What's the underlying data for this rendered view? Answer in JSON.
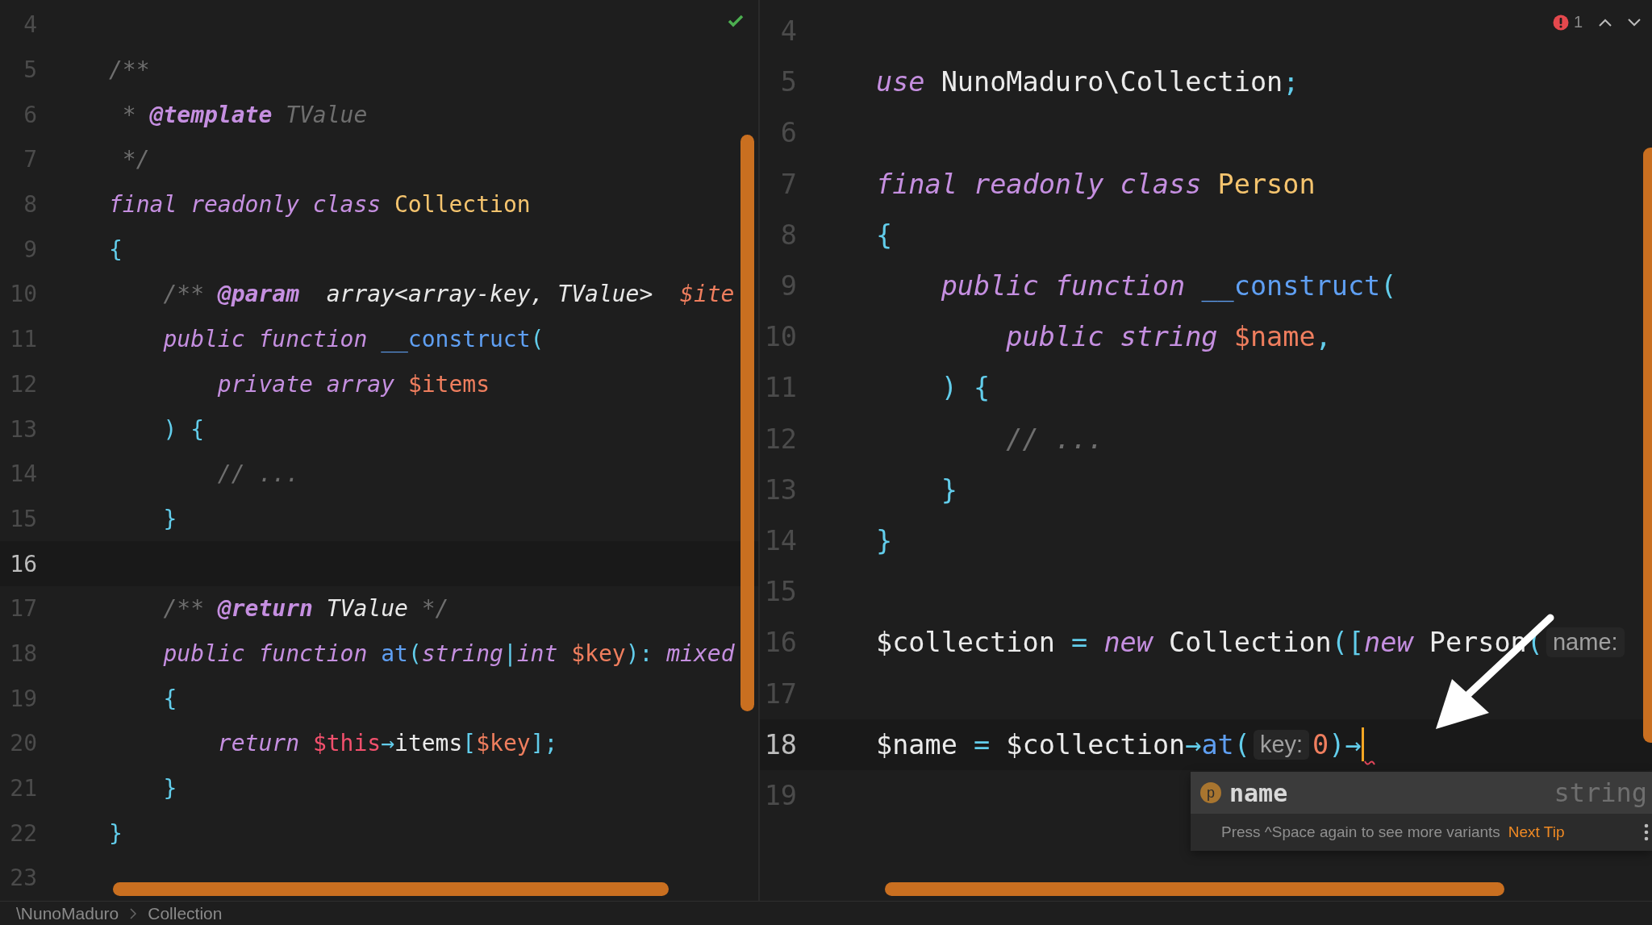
{
  "left_editor": {
    "has_errors": false,
    "lines": [
      {
        "number": "4",
        "current": false
      },
      {
        "number": "5",
        "current": false,
        "tokens": [
          {
            "kind": "comment",
            "text": "/**"
          }
        ]
      },
      {
        "number": "6",
        "current": false,
        "tokens": [
          {
            "kind": "comment",
            "text": " * "
          },
          {
            "kind": "doctag",
            "text": "@template"
          },
          {
            "kind": "comment",
            "text": " TValue"
          }
        ]
      },
      {
        "number": "7",
        "current": false,
        "tokens": [
          {
            "kind": "comment",
            "text": " */"
          }
        ]
      },
      {
        "number": "8",
        "current": false,
        "tokens": [
          {
            "kind": "keyword",
            "text": "final readonly class "
          },
          {
            "kind": "class",
            "text": "Collection"
          }
        ]
      },
      {
        "number": "9",
        "current": false,
        "tokens": [
          {
            "kind": "punct",
            "text": "{"
          }
        ]
      },
      {
        "number": "10",
        "current": false,
        "tokens": [
          {
            "kind": "comment",
            "text": "    /** "
          },
          {
            "kind": "doctag",
            "text": "@param"
          },
          {
            "kind": "doctype",
            "text": "  array<array-key, TValue>  "
          },
          {
            "kind": "docvar",
            "text": "$ite"
          }
        ]
      },
      {
        "number": "11",
        "current": false,
        "tokens": [
          {
            "kind": "keyword",
            "text": "    public function "
          },
          {
            "kind": "func",
            "text": "__construct"
          },
          {
            "kind": "punct",
            "text": "("
          }
        ]
      },
      {
        "number": "12",
        "current": false,
        "tokens": [
          {
            "kind": "keyword",
            "text": "        private array "
          },
          {
            "kind": "var",
            "text": "$items"
          }
        ]
      },
      {
        "number": "13",
        "current": false,
        "tokens": [
          {
            "kind": "punct",
            "text": "    ) {"
          }
        ]
      },
      {
        "number": "14",
        "current": false,
        "tokens": [
          {
            "kind": "comment",
            "text": "        // ..."
          }
        ]
      },
      {
        "number": "15",
        "current": false,
        "tokens": [
          {
            "kind": "punct",
            "text": "    }"
          }
        ]
      },
      {
        "number": "16",
        "current": true
      },
      {
        "number": "17",
        "current": false,
        "tokens": [
          {
            "kind": "comment",
            "text": "    /** "
          },
          {
            "kind": "doctag",
            "text": "@return"
          },
          {
            "kind": "doctype",
            "text": " TValue "
          },
          {
            "kind": "comment",
            "text": "*/"
          }
        ]
      },
      {
        "number": "18",
        "current": false,
        "tokens": [
          {
            "kind": "keyword",
            "text": "    public function "
          },
          {
            "kind": "func",
            "text": "at"
          },
          {
            "kind": "punct",
            "text": "("
          },
          {
            "kind": "keyword",
            "text": "string"
          },
          {
            "kind": "punct",
            "text": "|"
          },
          {
            "kind": "keyword",
            "text": "int "
          },
          {
            "kind": "var",
            "text": "$key"
          },
          {
            "kind": "punct",
            "text": "): "
          },
          {
            "kind": "keyword",
            "text": "mixed"
          }
        ]
      },
      {
        "number": "19",
        "current": false,
        "tokens": [
          {
            "kind": "punct",
            "text": "    {"
          }
        ]
      },
      {
        "number": "20",
        "current": false,
        "tokens": [
          {
            "kind": "keyword",
            "text": "        return "
          },
          {
            "kind": "this",
            "text": "$this"
          },
          {
            "kind": "punct",
            "text": "→"
          },
          {
            "kind": "plain",
            "text": "items"
          },
          {
            "kind": "punct",
            "text": "["
          },
          {
            "kind": "var",
            "text": "$key"
          },
          {
            "kind": "punct",
            "text": "];"
          }
        ]
      },
      {
        "number": "21",
        "current": false,
        "tokens": [
          {
            "kind": "punct",
            "text": "    }"
          }
        ]
      },
      {
        "number": "22",
        "current": false,
        "tokens": [
          {
            "kind": "punct",
            "text": "}"
          }
        ]
      },
      {
        "number": "23",
        "current": false
      }
    ]
  },
  "right_editor": {
    "has_errors": true,
    "problem_count": "1",
    "lines": [
      {
        "number": "4",
        "current": false
      },
      {
        "number": "5",
        "current": false,
        "tokens": [
          {
            "kind": "keyword",
            "text": "use "
          },
          {
            "kind": "plain",
            "text": "NunoMaduro\\Collection"
          },
          {
            "kind": "punct",
            "text": ";"
          }
        ]
      },
      {
        "number": "6",
        "current": false
      },
      {
        "number": "7",
        "current": false,
        "tokens": [
          {
            "kind": "keyword",
            "text": "final readonly class "
          },
          {
            "kind": "class",
            "text": "Person"
          }
        ]
      },
      {
        "number": "8",
        "current": false,
        "tokens": [
          {
            "kind": "punct",
            "text": "{"
          }
        ]
      },
      {
        "number": "9",
        "current": false,
        "tokens": [
          {
            "kind": "keyword",
            "text": "    public function "
          },
          {
            "kind": "func",
            "text": "__construct"
          },
          {
            "kind": "punct",
            "text": "("
          }
        ]
      },
      {
        "number": "10",
        "current": false,
        "tokens": [
          {
            "kind": "keyword",
            "text": "        public string "
          },
          {
            "kind": "var",
            "text": "$name"
          },
          {
            "kind": "punct",
            "text": ","
          }
        ]
      },
      {
        "number": "11",
        "current": false,
        "tokens": [
          {
            "kind": "punct",
            "text": "    ) {"
          }
        ]
      },
      {
        "number": "12",
        "current": false,
        "tokens": [
          {
            "kind": "comment",
            "text": "        // ..."
          }
        ]
      },
      {
        "number": "13",
        "current": false,
        "tokens": [
          {
            "kind": "punct",
            "text": "    }"
          }
        ]
      },
      {
        "number": "14",
        "current": false,
        "tokens": [
          {
            "kind": "punct",
            "text": "}"
          }
        ]
      },
      {
        "number": "15",
        "current": false
      },
      {
        "number": "16",
        "current": false,
        "tokens": [
          {
            "kind": "plain",
            "text": "$collection"
          },
          {
            "kind": "punct",
            "text": " = "
          },
          {
            "kind": "keyword",
            "text": "new "
          },
          {
            "kind": "plain",
            "text": "Collection"
          },
          {
            "kind": "punct",
            "text": "(["
          },
          {
            "kind": "keyword",
            "text": "new "
          },
          {
            "kind": "plain",
            "text": "Person"
          },
          {
            "kind": "punct",
            "text": "("
          },
          {
            "kind": "hint",
            "text": "name:"
          }
        ]
      },
      {
        "number": "17",
        "current": false
      },
      {
        "number": "18",
        "current": true,
        "tokens": [
          {
            "kind": "plain",
            "text": "$name"
          },
          {
            "kind": "punct",
            "text": " = "
          },
          {
            "kind": "plain",
            "text": "$collection"
          },
          {
            "kind": "punct",
            "text": "→"
          },
          {
            "kind": "func",
            "text": "at"
          },
          {
            "kind": "punct",
            "text": "("
          },
          {
            "kind": "hint",
            "text": "key:"
          },
          {
            "kind": "number",
            "text": "0"
          },
          {
            "kind": "punct",
            "text": ")→"
          },
          {
            "kind": "cursor"
          }
        ]
      },
      {
        "number": "19",
        "current": false
      }
    ],
    "completion_popup": {
      "items": [
        {
          "badge": "p",
          "label": "name",
          "type": "string",
          "selected": true
        }
      ],
      "footer": "Press ^Space again to see more variants",
      "tip_link": "Next Tip"
    }
  },
  "breadcrumbs": [
    "\\NunoMaduro",
    "Collection"
  ]
}
